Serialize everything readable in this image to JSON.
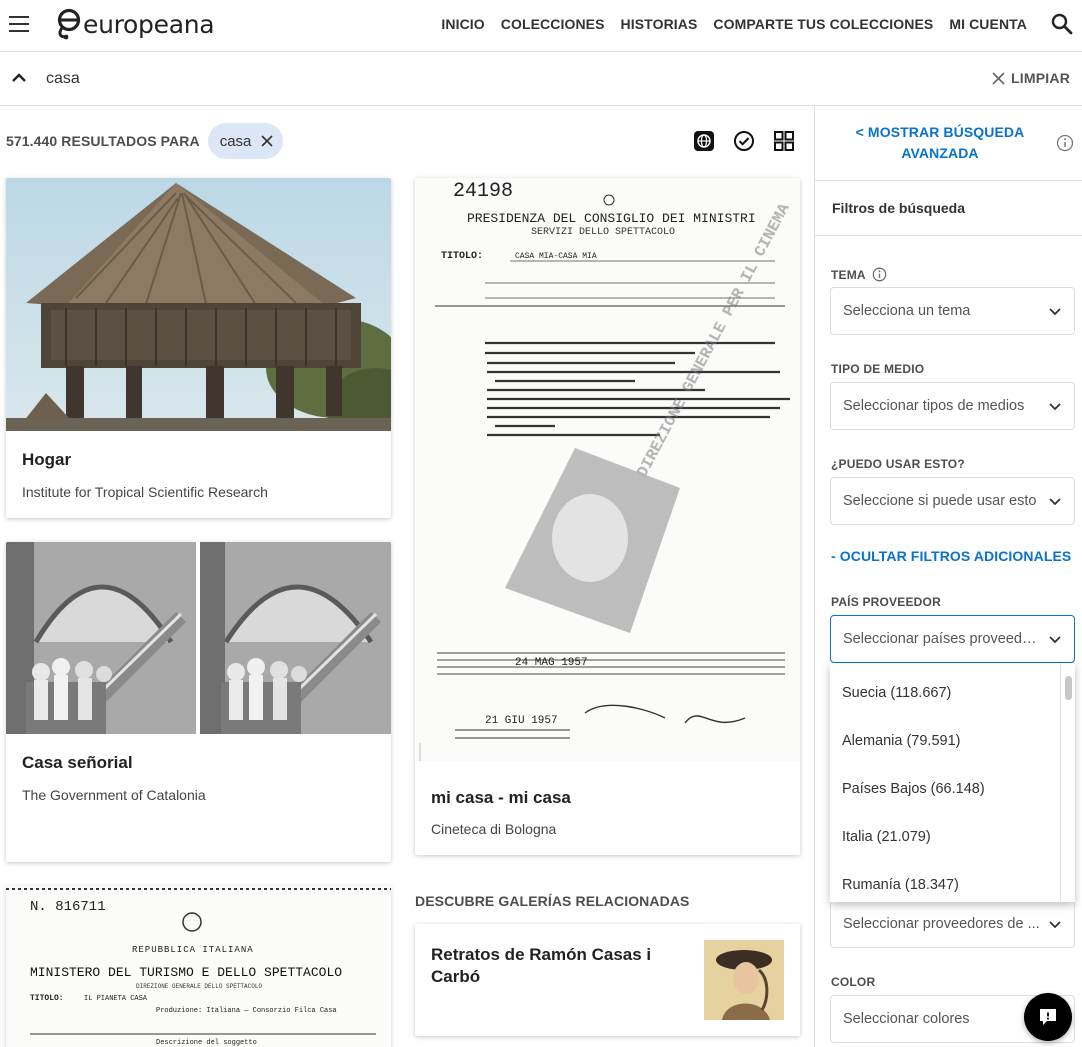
{
  "header": {
    "brand": "europeana",
    "nav": [
      "INICIO",
      "COLECCIONES",
      "HISTORIAS",
      "COMPARTE TUS COLECCIONES",
      "MI CUENTA"
    ]
  },
  "search": {
    "query": "casa",
    "clear_label": "LIMPIAR"
  },
  "results": {
    "count_label": "571.440 RESULTADOS PARA",
    "chip": "casa",
    "cards": [
      {
        "title": "Hogar",
        "provider": "Institute for Tropical Scientific Research"
      },
      {
        "title": "mi casa - mi casa",
        "provider": "Cineteca di Bologna"
      },
      {
        "title": "Casa señorial",
        "provider": "The Government of Catalonia"
      }
    ],
    "doc1": {
      "number": "24198",
      "line1": "PRESIDENZA DEL CONSIGLIO DEI MINISTRI",
      "line2": "SERVIZI DELLO SPETTACOLO",
      "titolo_label": "TITOLO:",
      "titolo_value": "CASA MIA-CASA MIA",
      "stamp": "DIREZIONE GENERALE PER IL CINEMA",
      "date1": "24 MAG 1957",
      "date2": "21 GIU 1957"
    },
    "doc2": {
      "number": "N. 816711",
      "line1": "REPUBBLICA ITALIANA",
      "line2": "MINISTERO DEL TURISMO E DELLO SPETTACOLO",
      "line3": "DIREZIONE GENERALE DELLO SPETTACOLO",
      "titolo_label": "TITOLO:",
      "titolo_value": "IL PIANETA CASA",
      "production": "Produzione: Italiana — Consorzio Filca Casa",
      "desc": "Descrizione del soggetto"
    },
    "gallery_section_label": "DESCUBRE GALERÍAS RELACIONADAS",
    "gallery": {
      "title": "Retratos de Ramón Casas i Carbó"
    }
  },
  "sidebar": {
    "advanced_line1": "< MOSTRAR BÚSQUEDA",
    "advanced_line2": "AVANZADA",
    "filters_title": "Filtros de búsqueda",
    "tema_label": "TEMA",
    "tema_placeholder": "Selecciona un tema",
    "medio_label": "TIPO DE MEDIO",
    "medio_placeholder": "Seleccionar tipos de medios",
    "uso_label": "¿PUEDO USAR ESTO?",
    "uso_placeholder": "Seleccione si puede usar esto",
    "hide_filters": "- OCULTAR FILTROS ADICIONALES",
    "pais_label": "PAÍS PROVEEDOR",
    "pais_placeholder": "Seleccionar países proveedo...",
    "pais_options": [
      "Suecia (118.667)",
      "Alemania (79.591)",
      "Países Bajos (66.148)",
      "Italia (21.079)",
      "Rumanía (18.347)"
    ],
    "proveedor_placeholder": "Seleccionar proveedores de ...",
    "color_label": "COLOR",
    "color_placeholder": "Seleccionar colores"
  },
  "colors": {
    "link_blue": "#0a72cc",
    "chip_bg": "#dbe7f6"
  }
}
